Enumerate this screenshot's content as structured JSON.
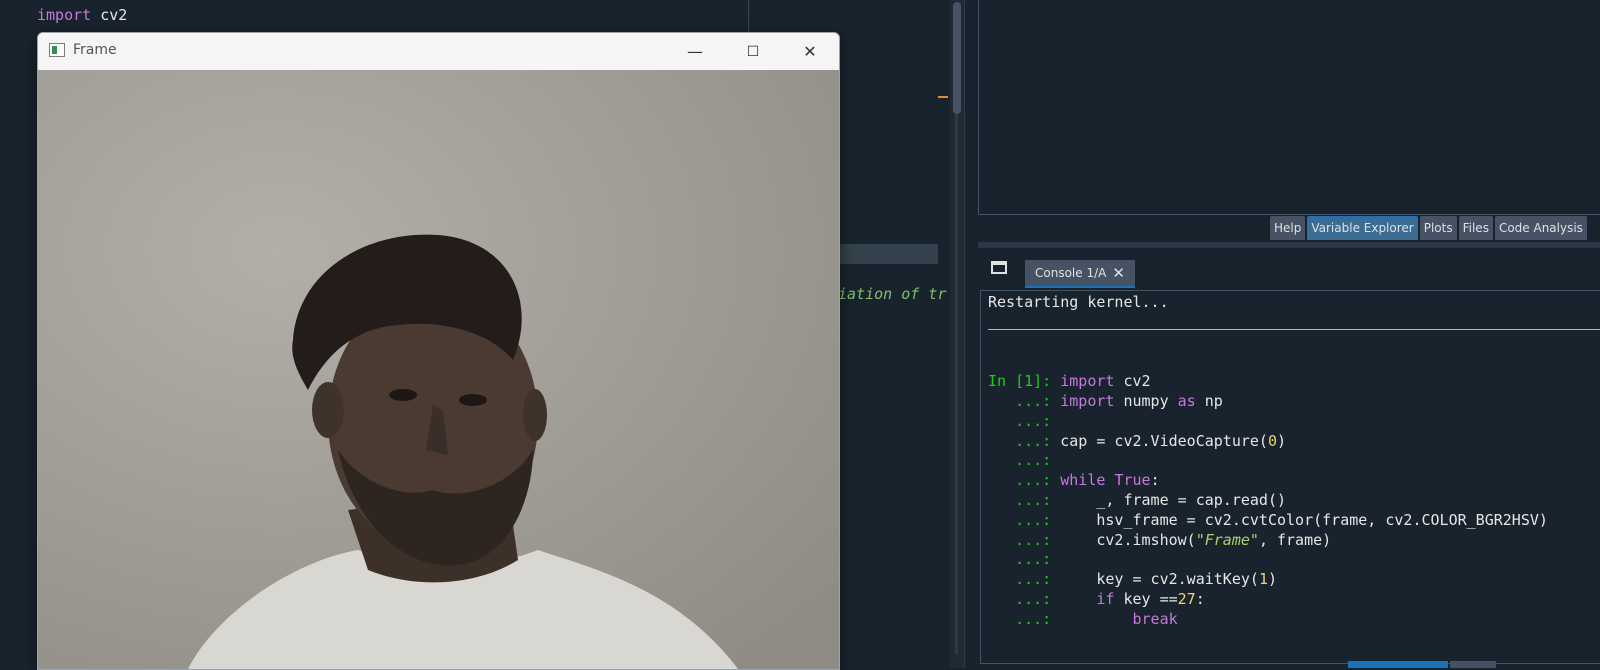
{
  "editor": {
    "lines": [
      {
        "kw": "import",
        "rest": " cv2"
      }
    ],
    "comment_fragment": "iation of tr"
  },
  "top_pane": {
    "tabs": [
      "Help",
      "Variable Explorer",
      "Plots",
      "Files",
      "Code Analysis"
    ],
    "active_tab": "Variable Explorer"
  },
  "console": {
    "tab_label": "Console 1/A",
    "restart_msg": "Restarting kernel...",
    "prompt_in": "In [1]:",
    "cont_prompt": "...:",
    "code_lines": [
      "import cv2",
      "import numpy as np",
      "",
      "cap = cv2.VideoCapture(0)",
      "",
      "while True:",
      "    _, frame = cap.read()",
      "    hsv_frame = cv2.cvtColor(frame, cv2.COLOR_BGR2HSV)",
      "    cv2.imshow(\"Frame\", frame)",
      "",
      "    key = cv2.waitKey(1)",
      "    if key ==27:",
      "        break"
    ]
  },
  "frame_window": {
    "title": "Frame",
    "minimize": "—",
    "maximize": "☐",
    "close": "✕"
  },
  "colors": {
    "background": "#19232d",
    "accent": "#1a72bb",
    "keyword": "#c678dd",
    "prompt": "#1dcb1d"
  }
}
